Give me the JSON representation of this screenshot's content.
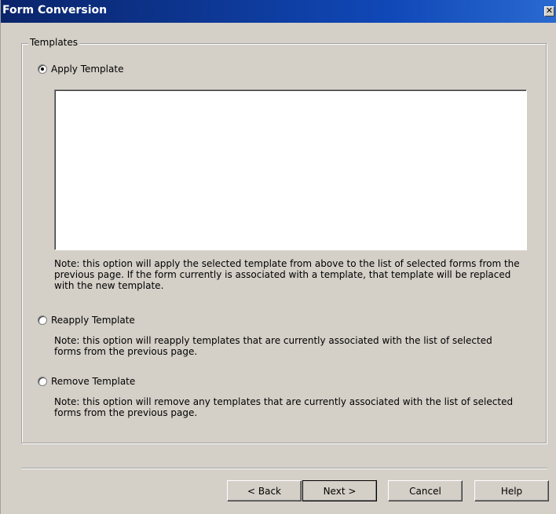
{
  "window": {
    "title": "Form Conversion",
    "close_glyph": "✕"
  },
  "group": {
    "legend": "Templates"
  },
  "options": [
    {
      "label": "Apply Template",
      "checked": true,
      "note_line1": "Note: this option will apply the selected template from above to the list of selected forms from the",
      "note_line2": "previous page.  If the form currently is associated with a template, that template will be replaced",
      "note_line3": "with the new template."
    },
    {
      "label": "Reapply Template",
      "checked": false,
      "note_line1": "Note: this option will reapply templates that are currently associated with the list of selected",
      "note_line2": "forms from the previous page."
    },
    {
      "label": "Remove Template",
      "checked": false,
      "note_line1": "Note: this option will remove any templates that are currently associated with the list of selected",
      "note_line2": "forms from the previous page."
    }
  ],
  "buttons": {
    "back": "< Back",
    "next": "Next >",
    "cancel": "Cancel",
    "help": "Help"
  },
  "colors": {
    "titlebar": "#0a246a",
    "dialog_bg": "#d4d0c8"
  }
}
